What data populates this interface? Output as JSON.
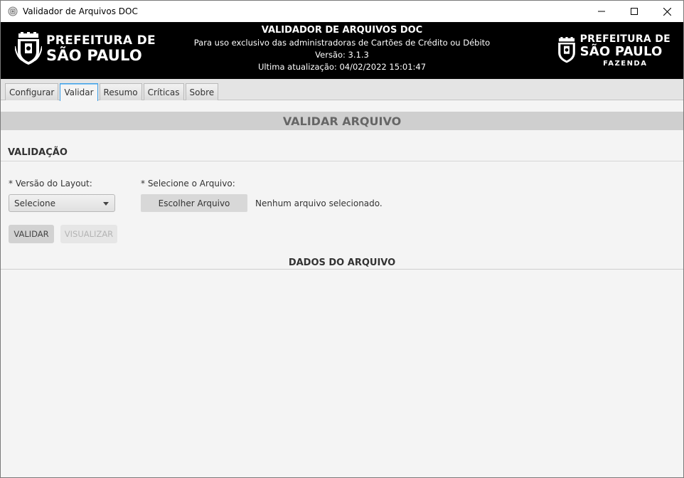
{
  "window": {
    "title": "Validador de Arquivos DOC"
  },
  "banner": {
    "left_logo": {
      "line1": "PREFEITURA DE",
      "line2": "SÃO PAULO"
    },
    "title": "VALIDADOR DE ARQUIVOS DOC",
    "subtitle": "Para uso exclusivo das administradoras de Cartões de Crédito ou Débito",
    "version": "Versão: 3.1.3",
    "last_update": "Ultima atualização: 04/02/2022 15:01:47",
    "right_logo": {
      "line1": "PREFEITURA DE",
      "line2": "SÃO PAULO",
      "line3": "FAZENDA"
    }
  },
  "tabs": [
    {
      "label": "Configurar"
    },
    {
      "label": "Validar",
      "active": true
    },
    {
      "label": "Resumo"
    },
    {
      "label": "Críticas"
    },
    {
      "label": "Sobre"
    }
  ],
  "main": {
    "section_title": "VALIDAR ARQUIVO",
    "subsection_title": "VALIDAÇÃO",
    "layout_version_label": "* Versão do Layout:",
    "layout_version_value": "Selecione",
    "file_label": "* Selecione o Arquivo:",
    "choose_file_button": "Escolher Arquivo",
    "file_status": "Nenhum arquivo selecionado.",
    "validate_button": "VALIDAR",
    "view_button": "VISUALIZAR",
    "file_data_title": "DADOS DO ARQUIVO"
  },
  "colors": {
    "banner_bg": "#000000",
    "active_tab_border": "#3c9ee6",
    "section_header_bg": "#cfcfcf"
  },
  "icons": {
    "app": "city-seal-icon",
    "minimize": "minimize-icon",
    "maximize": "maximize-icon",
    "close": "close-icon"
  }
}
